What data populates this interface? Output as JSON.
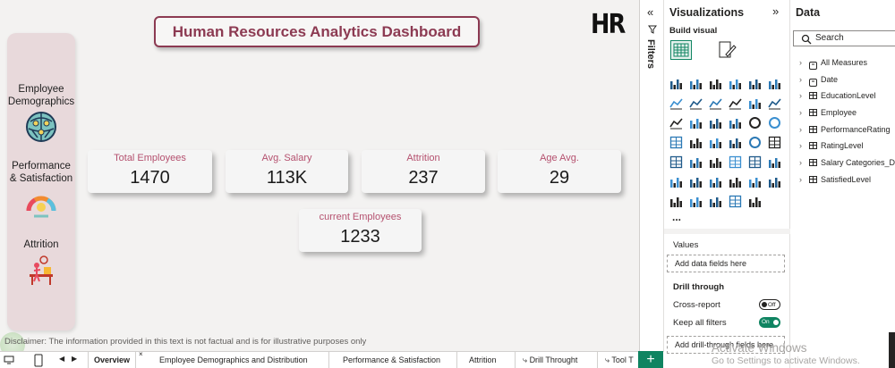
{
  "report": {
    "title": "Human Resources Analytics Dashboard",
    "logo_text": "HR",
    "disclaimer": "Disclaimer: The information provided in this text is not factual and is for illustrative purposes only"
  },
  "side_nav": {
    "items": [
      {
        "label": "Employee Demographics",
        "icon": "demographics-globe-icon"
      },
      {
        "label": "Performance & Satisfaction",
        "icon": "satisfaction-gauge-icon"
      },
      {
        "label": "Attrition",
        "icon": "attrition-person-icon"
      }
    ]
  },
  "kpis": [
    {
      "label": "Total Employees",
      "value": "1470"
    },
    {
      "label": "Avg. Salary",
      "value": "113K"
    },
    {
      "label": "Attrition",
      "value": "237"
    },
    {
      "label": "Age Avg.",
      "value": "29"
    },
    {
      "label": "current Employees",
      "value": "1233"
    }
  ],
  "page_tabs": [
    {
      "label": "Overview",
      "active": true
    },
    {
      "label": "Employee Demographics and Distribution",
      "active": false
    },
    {
      "label": "Performance & Satisfaction",
      "active": false
    },
    {
      "label": "Attrition",
      "active": false
    },
    {
      "label": "Drill Throught",
      "active": false
    },
    {
      "label": "Tool T",
      "active": false
    }
  ],
  "filters": {
    "label": "Filters"
  },
  "visualizations": {
    "title": "Visualizations",
    "build_visual": "Build visual",
    "values_label": "Values",
    "values_placeholder": "Add data fields here",
    "drill_label": "Drill through",
    "cross_report": {
      "label": "Cross-report",
      "state": "Off"
    },
    "keep_filters": {
      "label": "Keep all filters",
      "state": "On"
    },
    "drill_placeholder": "Add drill-through fields here",
    "more": "..."
  },
  "data_pane": {
    "title": "Data",
    "search_placeholder": "Search",
    "fields": [
      {
        "label": "All Measures",
        "kind": "calc"
      },
      {
        "label": "Date",
        "kind": "calc"
      },
      {
        "label": "EducationLevel",
        "kind": "table"
      },
      {
        "label": "Employee",
        "kind": "table"
      },
      {
        "label": "PerformanceRating",
        "kind": "table"
      },
      {
        "label": "RatingLevel",
        "kind": "table"
      },
      {
        "label": "Salary Categories_D",
        "kind": "table"
      },
      {
        "label": "SatisfiedLevel",
        "kind": "table"
      }
    ]
  },
  "watermark": {
    "title": "Activate Windows",
    "subtitle": "Go to Settings to activate Windows."
  },
  "colors": {
    "accent_maroon": "#8c3a52",
    "kpi_label_pink": "#b5516f",
    "powerbi_green": "#0f8461",
    "side_panel": "#e8d9db",
    "canvas": "#f3f2f1"
  }
}
